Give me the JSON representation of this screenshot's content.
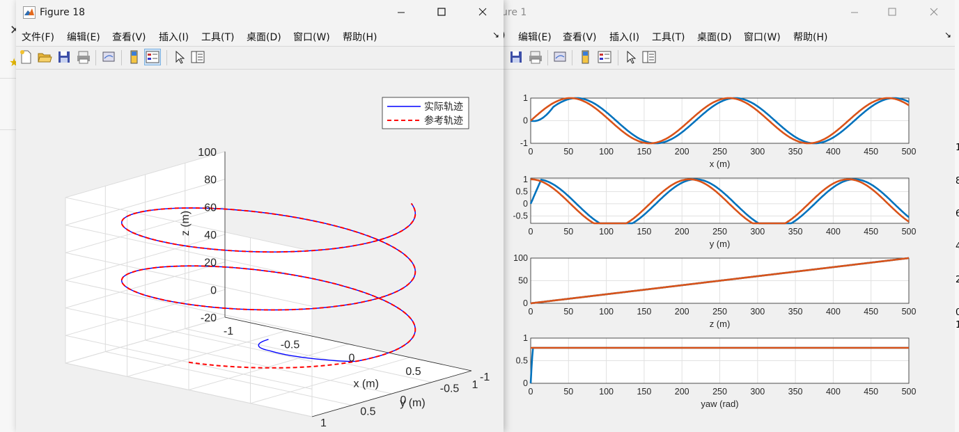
{
  "background_window": {
    "title_fragment": "ure 1",
    "menu": [
      ")",
      "编辑(E)",
      "查看(V)",
      "插入(I)",
      "工具(T)",
      "桌面(D)",
      "窗口(W)",
      "帮助(H)"
    ],
    "edge_labels": [
      "1",
      "8",
      "6",
      "4",
      "2",
      "0",
      "1"
    ]
  },
  "figure18": {
    "title": "Figure 18",
    "menu": [
      "文件(F)",
      "编辑(E)",
      "查看(V)",
      "插入(I)",
      "工具(T)",
      "桌面(D)",
      "窗口(W)",
      "帮助(H)"
    ],
    "chart_data": {
      "type": "line",
      "title": "",
      "xlabel": "x (m)",
      "ylabel": "y (m)",
      "zlabel": "z (m)",
      "xlim": [
        -1,
        1
      ],
      "ylim": [
        -1,
        1
      ],
      "zlim": [
        -20,
        100
      ],
      "x_ticks": [
        "-1",
        "-0.5",
        "0",
        "0.5",
        "1"
      ],
      "y_ticks": [
        "-1",
        "-0.5",
        "0",
        "0.5",
        "1"
      ],
      "z_ticks": [
        "-20",
        "0",
        "20",
        "40",
        "60",
        "80",
        "100"
      ],
      "legend": {
        "position": "top-right",
        "entries": [
          "实际轨迹",
          "参考轨迹"
        ]
      },
      "series": [
        {
          "name": "实际轨迹",
          "color": "#0000ff",
          "style": "solid",
          "t_range": [
            0,
            500
          ],
          "start_point": [
            0,
            0,
            0
          ],
          "x": "sin(2π t/210)",
          "y": "cos(2π t/210)",
          "z": "t/5"
        },
        {
          "name": "参考轨迹",
          "color": "#ff0000",
          "style": "dashed",
          "t_range": [
            0,
            500
          ],
          "x": "sin(2π t/210)",
          "y": "cos(2π t/210)",
          "z": "t/5"
        }
      ]
    }
  },
  "figure1": {
    "chart_data": [
      {
        "type": "line",
        "xlabel": "x (m)",
        "xlim": [
          0,
          500
        ],
        "ylim": [
          -1,
          1
        ],
        "x_ticks": [
          "0",
          "50",
          "100",
          "150",
          "200",
          "250",
          "300",
          "350",
          "400",
          "450",
          "500"
        ],
        "y_ticks": [
          "-1",
          "0",
          "1"
        ],
        "series": [
          {
            "color": "#0072bd",
            "curve": "sin lagged, starts 0"
          },
          {
            "color": "#d95319",
            "curve": "sin(2π t/210)"
          }
        ]
      },
      {
        "type": "line",
        "xlabel": "y (m)",
        "xlim": [
          0,
          500
        ],
        "ylim": [
          -0.8,
          1
        ],
        "x_ticks": [
          "0",
          "50",
          "100",
          "150",
          "200",
          "250",
          "300",
          "350",
          "400",
          "450",
          "500"
        ],
        "y_ticks": [
          "-0.5",
          "0",
          "0.5",
          "1"
        ],
        "series": [
          {
            "color": "#0072bd",
            "curve": "cos lagged, starts 0"
          },
          {
            "color": "#d95319",
            "curve": "cos(2π t/210)"
          }
        ]
      },
      {
        "type": "line",
        "xlabel": "z (m)",
        "xlim": [
          0,
          500
        ],
        "ylim": [
          0,
          100
        ],
        "x_ticks": [
          "0",
          "50",
          "100",
          "150",
          "200",
          "250",
          "300",
          "350",
          "400",
          "450",
          "500"
        ],
        "y_ticks": [
          "0",
          "50",
          "100"
        ],
        "series": [
          {
            "color": "#0072bd",
            "curve": "t/5"
          },
          {
            "color": "#d95319",
            "curve": "t/5"
          }
        ]
      },
      {
        "type": "line",
        "xlabel": "yaw (rad)",
        "xlim": [
          0,
          500
        ],
        "ylim": [
          0,
          1
        ],
        "x_ticks": [
          "0",
          "50",
          "100",
          "150",
          "200",
          "250",
          "300",
          "350",
          "400",
          "450",
          "500"
        ],
        "y_ticks": [
          "0",
          "0.5",
          "1"
        ],
        "series": [
          {
            "color": "#0072bd",
            "curve": "step to 0.785"
          },
          {
            "color": "#d95319",
            "curve": "0.785"
          }
        ]
      }
    ]
  }
}
